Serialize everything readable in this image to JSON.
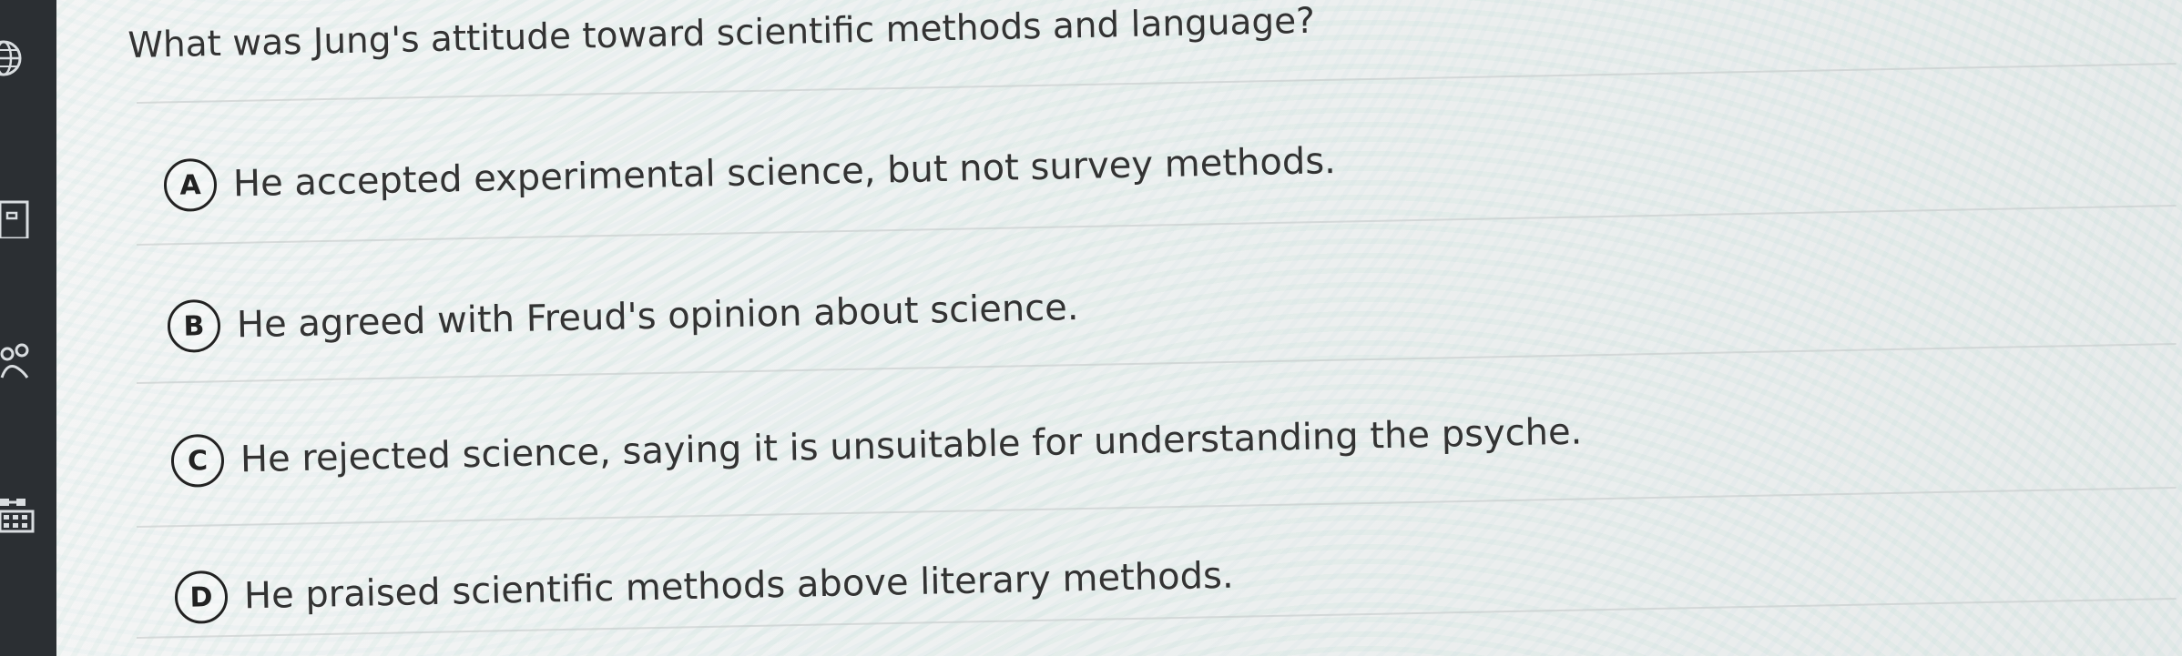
{
  "question": {
    "text": "What was Jung's attitude toward scientific methods and language?"
  },
  "options": [
    {
      "letter": "A",
      "text": "He accepted experimental science, but not survey methods."
    },
    {
      "letter": "B",
      "text": "He agreed with Freud's opinion about science."
    },
    {
      "letter": "C",
      "text": "He rejected science, saying it is unsuitable for understanding the psyche."
    },
    {
      "letter": "D",
      "text": "He praised scientific methods above literary methods."
    }
  ],
  "sidebar": {
    "icons": [
      "globe-icon",
      "book-icon",
      "people-icon",
      "grid-icon"
    ],
    "background_color": "#2b2f33",
    "icon_color": "#d9dde0"
  }
}
